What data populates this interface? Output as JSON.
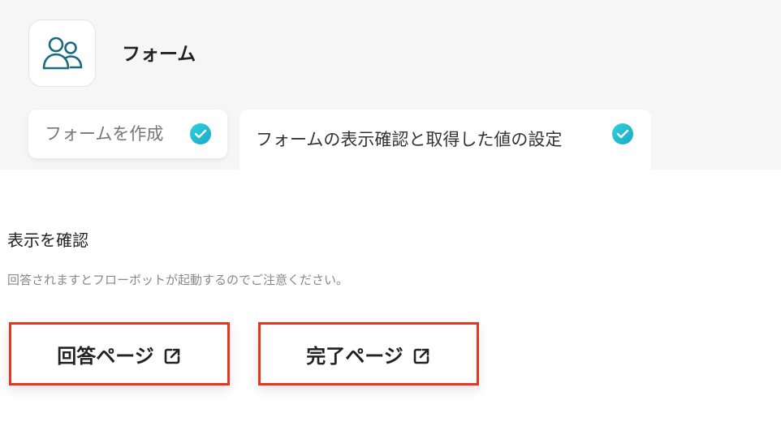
{
  "app": {
    "title": "フォーム",
    "icon": "users-icon"
  },
  "tabs": [
    {
      "label": "フォームを作成",
      "state": "completed",
      "icon": "check-circle-icon"
    },
    {
      "label": "フォームの表示確認と取得した値の設定",
      "state": "completed",
      "icon": "check-circle-icon"
    }
  ],
  "section": {
    "heading": "表示を確認",
    "notice": "回答されますとフローボットが起動するのでご注意ください。"
  },
  "buttons": {
    "answer_page": {
      "label": "回答ページ",
      "icon": "external-link-icon"
    },
    "complete_page": {
      "label": "完了ページ",
      "icon": "external-link-icon"
    }
  },
  "colors": {
    "accent": "#1fb8d0",
    "highlight_border": "#e8351f",
    "icon_stroke": "#1b6a80"
  }
}
